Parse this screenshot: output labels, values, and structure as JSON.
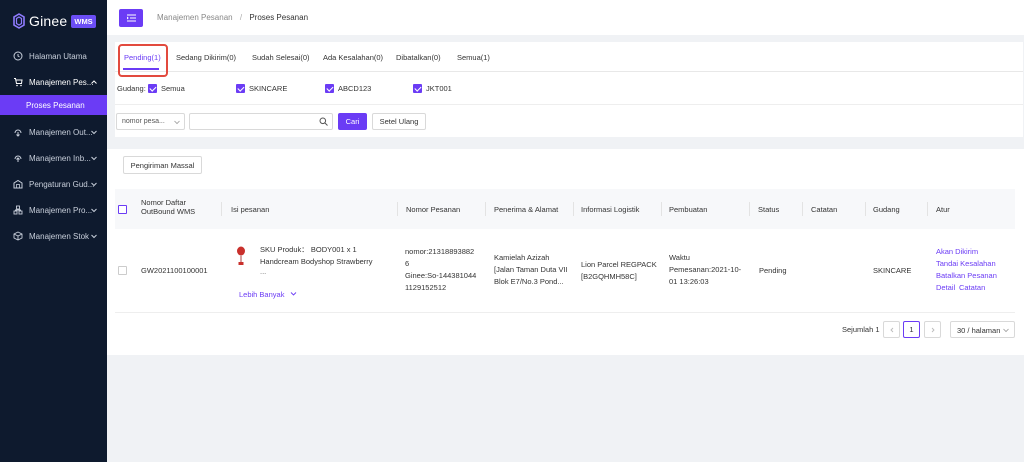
{
  "sidebar": {
    "logo_text": "Ginee",
    "logo_badge": "WMS",
    "items": [
      {
        "label": "Halaman Utama",
        "icon": "home-icon"
      },
      {
        "label": "Manajemen Pes...",
        "icon": "cart-icon"
      },
      {
        "label": "Manajemen Out...",
        "icon": "outbound-icon"
      },
      {
        "label": "Manajemen Inb...",
        "icon": "inbound-icon"
      },
      {
        "label": "Pengaturan Gud...",
        "icon": "warehouse-icon"
      },
      {
        "label": "Manajemen Pro...",
        "icon": "product-icon"
      },
      {
        "label": "Manajemen Stok",
        "icon": "stock-icon"
      }
    ],
    "active_sub": "Proses Pesanan"
  },
  "breadcrumb": {
    "parent": "Manajemen Pesanan",
    "separator": "/",
    "current": "Proses Pesanan"
  },
  "tabs": [
    "Pending(1)",
    "Sedang Dikirim(0)",
    "Sudah Selesai(0)",
    "Ada Kesalahan(0)",
    "Dibatalkan(0)",
    "Semua(1)"
  ],
  "filters": {
    "gudang_label": "Gudang:",
    "warehouses": [
      "Semua",
      "SKINCARE",
      "ABCD123",
      "JKT001"
    ],
    "search_select": "nomor pesa...",
    "search_value": "",
    "search_button": "Cari",
    "reset_button": "Setel Ulang"
  },
  "actions": {
    "mass_ship": "Pengiriman Massal"
  },
  "table": {
    "headers": {
      "outbound_no_1": "Nomor Daftar",
      "outbound_no_2": "OutBound WMS",
      "content": "Isi pesanan",
      "order_no": "Nomor Pesanan",
      "receiver": "Penerima & Alamat",
      "logistics": "Informasi Logistik",
      "created": "Pembuatan",
      "status": "Status",
      "notes": "Catatan",
      "warehouse": "Gudang",
      "actions": "Atur"
    },
    "row": {
      "outbound_no": "GW2021100100001",
      "sku_line": "SKU Produk： BODY001 x 1",
      "product_name": "Handcream Bodyshop Strawberry",
      "ellipsis": "...",
      "more": "Lebih Banyak",
      "order_no_1": "nomor:21318893882",
      "order_no_2": "6",
      "order_no_3": "Ginee:So-144381044",
      "order_no_4": "1129152512",
      "receiver_1": "Kamielah Azizah",
      "receiver_2": "[Jalan Taman Duta VII",
      "receiver_3": "Blok E7/No.3 Pond...",
      "logistics_1": "Lion Parcel REGPACK",
      "logistics_2": "[B2GQHMH58C]",
      "created_1": "Waktu",
      "created_2": "Pemesanan:2021-10-",
      "created_3": "01 13:26:03",
      "status": "Pending",
      "notes": "",
      "warehouse": "SKINCARE",
      "actions": [
        "Akan Dikirim",
        "Tandai Kesalahan",
        "Batalkan Pesanan",
        "Detail",
        "Catatan"
      ]
    }
  },
  "pagination": {
    "total": "Sejumlah 1",
    "current_page": "1",
    "page_size": "30 / halaman"
  },
  "colors": {
    "accent": "#6b3cf5",
    "sidebar_bg": "#0e1a2e",
    "highlight": "#e24a3e"
  }
}
